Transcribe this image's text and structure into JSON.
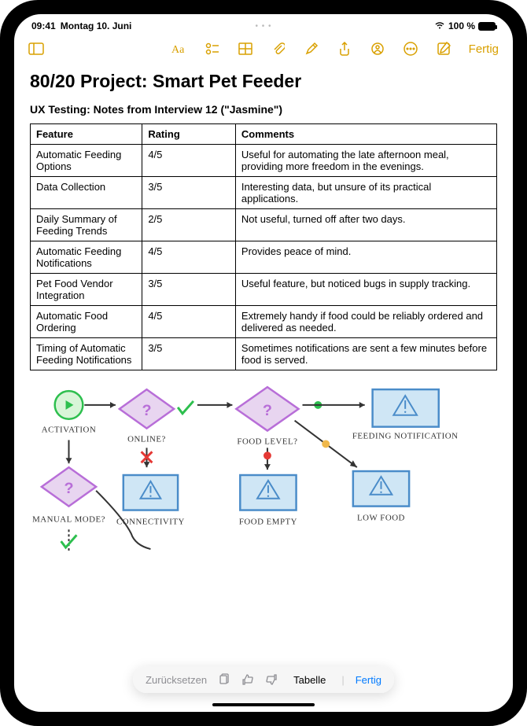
{
  "status": {
    "time": "09:41",
    "date": "Montag 10. Juni",
    "battery_pct": "100 %"
  },
  "toolbar": {
    "done": "Fertig"
  },
  "note": {
    "title": "80/20 Project: Smart Pet Feeder",
    "subtitle": "UX Testing: Notes from Interview 12 (\"Jasmine\")"
  },
  "table": {
    "headers": {
      "feature": "Feature",
      "rating": "Rating",
      "comments": "Comments"
    },
    "rows": [
      {
        "feature": "Automatic Feeding Options",
        "rating": "4/5",
        "comments": "Useful for automating the late afternoon meal, providing more freedom in the evenings."
      },
      {
        "feature": "Data Collection",
        "rating": "3/5",
        "comments": "Interesting data, but unsure of its practical applications."
      },
      {
        "feature": "Daily Summary of Feeding Trends",
        "rating": "2/5",
        "comments": "Not useful, turned off after two days."
      },
      {
        "feature": "Automatic Feeding Notifications",
        "rating": "4/5",
        "comments": "Provides peace of mind."
      },
      {
        "feature": "Pet Food Vendor Integration",
        "rating": "3/5",
        "comments": "Useful feature, but noticed bugs in supply tracking."
      },
      {
        "feature": "Automatic Food Ordering",
        "rating": "4/5",
        "comments": "Extremely handy if food could be reliably ordered and delivered as needed."
      },
      {
        "feature": "Timing of Automatic Feeding Notifications",
        "rating": "3/5",
        "comments": "Sometimes notifications are sent a few minutes before food is served."
      }
    ]
  },
  "diagram": {
    "activation": "Activation",
    "online": "Online?",
    "manual": "Manual Mode?",
    "connectivity": "Connectivity",
    "food_level": "Food Level?",
    "food_empty": "Food Empty",
    "low_food": "Low Food",
    "feeding_notification": "Feeding Notification"
  },
  "action_bar": {
    "reset": "Zurücksetzen",
    "label": "Tabelle",
    "done": "Fertig"
  }
}
